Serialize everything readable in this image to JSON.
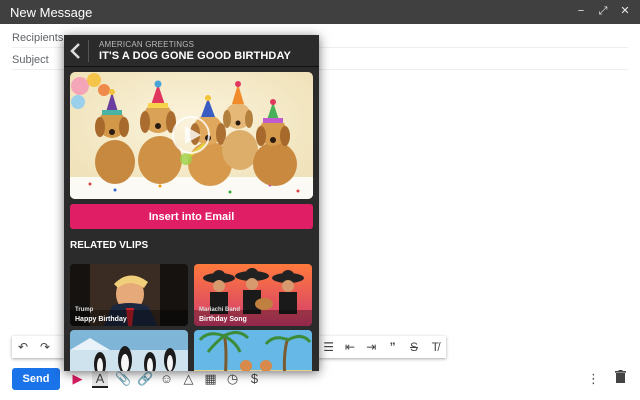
{
  "compose": {
    "title": "New Message",
    "recipients_label": "Recipients",
    "subject_label": "Subject",
    "send_label": "Send"
  },
  "vlip_panel": {
    "brand": "AMERICAN GREETINGS",
    "title": "IT'S A DOG GONE GOOD BIRTHDAY",
    "insert_label": "Insert into Email",
    "related_heading": "RELATED VLIPS",
    "related": [
      {
        "artist": "Trump",
        "song": "Happy Birthday"
      },
      {
        "artist": "Mariachi Band",
        "song": "Birthday Song"
      },
      {
        "artist": "",
        "song": ""
      },
      {
        "artist": "",
        "song": ""
      }
    ]
  },
  "icons": {
    "minimize": "minimize-icon",
    "fullscreen": "fullscreen-icon",
    "close": "close-icon",
    "undo": "undo-icon",
    "redo": "redo-icon",
    "attach": "paperclip-icon",
    "link": "link-icon",
    "emoji": "emoji-icon",
    "drive": "drive-icon",
    "photo": "photo-icon",
    "confidential": "lock-clock-icon",
    "money": "dollar-icon",
    "more": "more-vert-icon",
    "trash": "trash-icon"
  },
  "colors": {
    "titlebar": "#404040",
    "send": "#1a73e8",
    "insert": "#e01e66",
    "panel": "#2b2b2b"
  }
}
